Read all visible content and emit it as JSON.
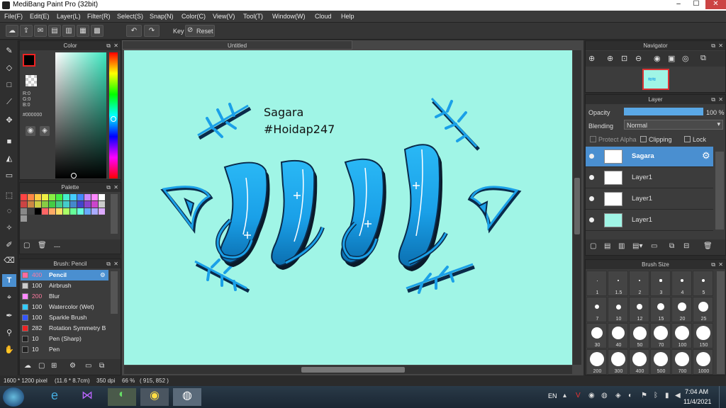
{
  "window": {
    "title": "MediBang Paint Pro (32bit)",
    "minimize": "–",
    "maximize": "☐",
    "close": "✕"
  },
  "menu": [
    "File(F)",
    "Edit(E)",
    "Layer(L)",
    "Filter(R)",
    "Select(S)",
    "Snap(N)",
    "Color(C)",
    "View(V)",
    "Tool(T)",
    "Window(W)",
    "Cloud",
    "Help"
  ],
  "toolbar": {
    "key_label": "Key",
    "reset_label": "Reset"
  },
  "color_panel": {
    "title": "Color",
    "r": "R:0",
    "g": "G:0",
    "b": "B:0",
    "hex": "#000000"
  },
  "palette_panel": {
    "title": "Palette",
    "dashes": "---"
  },
  "brush_panel": {
    "title": "Brush: Pencil",
    "items": [
      {
        "size": "400",
        "name": "Pencil",
        "color": "#ff6aa0"
      },
      {
        "size": "100",
        "name": "Airbrush",
        "color": "#cccccc"
      },
      {
        "size": "200",
        "name": "Blur",
        "color": "#ff88ff"
      },
      {
        "size": "100",
        "name": "Watercolor (Wet)",
        "color": "#33ccff"
      },
      {
        "size": "100",
        "name": "Sparkle Brush",
        "color": "#3355ff"
      },
      {
        "size": "282",
        "name": "Rotation Symmetry B",
        "color": "#ee2222"
      },
      {
        "size": "10",
        "name": "Pen (Sharp)",
        "color": "#222222"
      },
      {
        "size": "10",
        "name": "Pen",
        "color": "#222222"
      }
    ]
  },
  "document": {
    "tab": "Untitled",
    "text_line1": "Sagara",
    "text_line2": "#Hoidap247"
  },
  "navigator": {
    "title": "Navigator"
  },
  "layer_panel": {
    "title": "Layer",
    "opacity_label": "Opacity",
    "opacity_value": "100 %",
    "blending_label": "Blending",
    "blending_value": "Normal",
    "protect_alpha": "Protect Alpha",
    "clipping": "Clipping",
    "lock": "Lock",
    "layers": [
      {
        "name": "Sagara"
      },
      {
        "name": "Layer1"
      },
      {
        "name": "Layer1"
      },
      {
        "name": "Layer1"
      }
    ]
  },
  "brush_size_panel": {
    "title": "Brush Size",
    "sizes": [
      "1",
      "1.5",
      "2",
      "3",
      "4",
      "5",
      "7",
      "10",
      "12",
      "15",
      "20",
      "25",
      "30",
      "40",
      "50",
      "70",
      "100",
      "150",
      "200",
      "300",
      "400",
      "500",
      "700",
      "1000"
    ]
  },
  "status": {
    "dimensions": "1600 * 1200 pixel",
    "size_cm": "(11.6 * 8.7cm)",
    "dpi": "350 dpi",
    "zoom": "66 %",
    "coords": "( 915, 852 )"
  },
  "taskbar": {
    "lang": "EN",
    "time": "7:04 AM",
    "date": "11/4/2021"
  },
  "colors": {
    "accent": "#4a90d9",
    "canvas_bg": "#a0f5e6",
    "shape_blue": "#1aa0e8",
    "selected_row": "#4a8fd0"
  }
}
